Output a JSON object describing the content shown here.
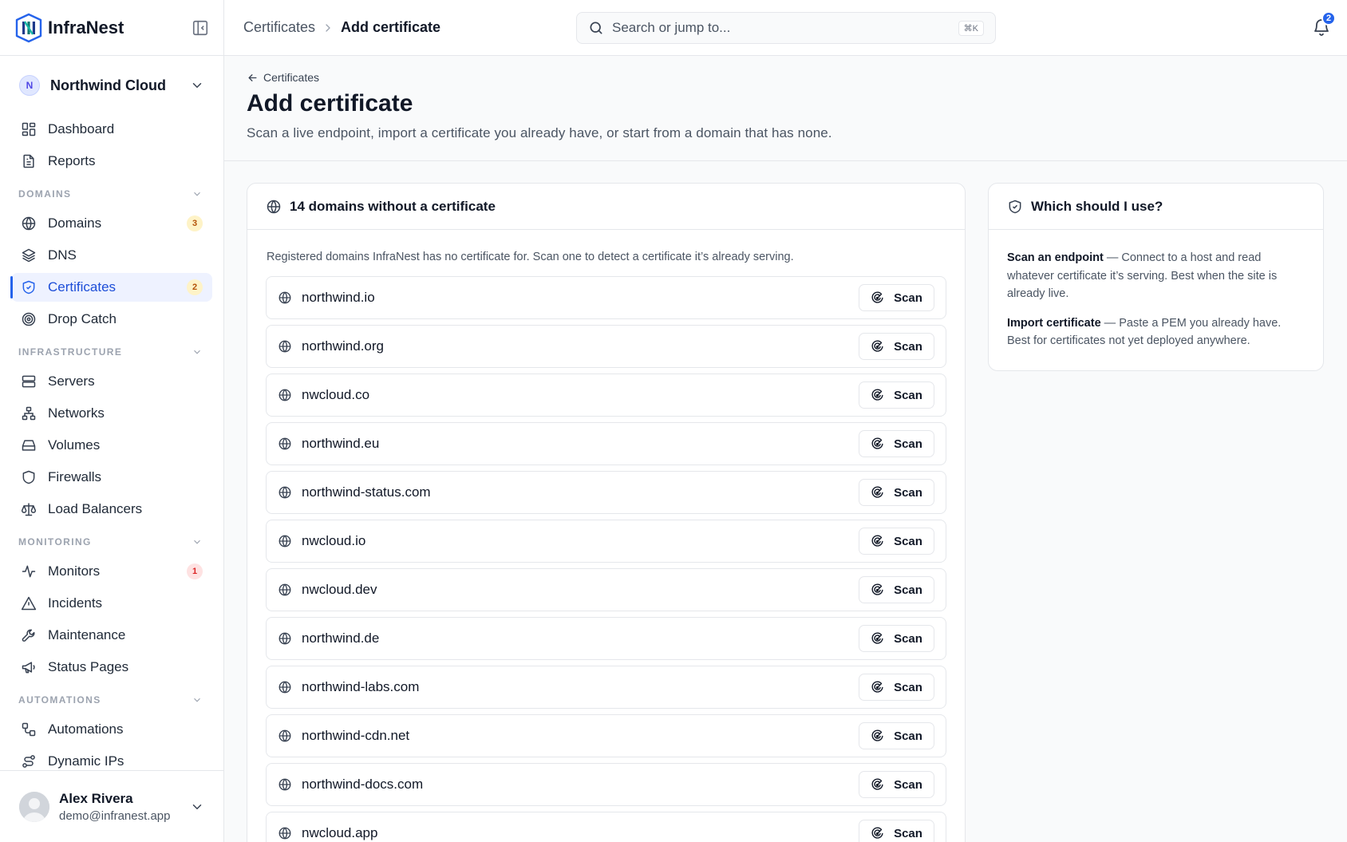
{
  "app": {
    "name": "InfraNest",
    "brand_color": "#2563eb",
    "accent_colors": {
      "amber_badge": "#b45309",
      "red_badge": "#dc2626"
    }
  },
  "workspace": {
    "initial": "N",
    "name": "Northwind Cloud"
  },
  "sidebar": {
    "top_items": [
      {
        "label": "Dashboard",
        "icon": "dashboard-icon"
      },
      {
        "label": "Reports",
        "icon": "document-icon"
      }
    ],
    "sections": [
      {
        "title": "DOMAINS",
        "items": [
          {
            "label": "Domains",
            "icon": "globe-icon",
            "badge": "3"
          },
          {
            "label": "DNS",
            "icon": "layers-icon"
          },
          {
            "label": "Certificates",
            "icon": "shield-check-icon",
            "badge": "2",
            "active": true
          },
          {
            "label": "Drop Catch",
            "icon": "target-icon"
          }
        ]
      },
      {
        "title": "INFRASTRUCTURE",
        "items": [
          {
            "label": "Servers",
            "icon": "server-icon"
          },
          {
            "label": "Networks",
            "icon": "network-icon"
          },
          {
            "label": "Volumes",
            "icon": "hard-drive-icon"
          },
          {
            "label": "Firewalls",
            "icon": "shield-icon"
          },
          {
            "label": "Load Balancers",
            "icon": "scale-icon"
          }
        ]
      },
      {
        "title": "MONITORING",
        "items": [
          {
            "label": "Monitors",
            "icon": "activity-icon",
            "badge": "1"
          },
          {
            "label": "Incidents",
            "icon": "alert-triangle-icon"
          },
          {
            "label": "Maintenance",
            "icon": "wrench-icon"
          },
          {
            "label": "Status Pages",
            "icon": "megaphone-icon"
          }
        ]
      },
      {
        "title": "AUTOMATIONS",
        "items": [
          {
            "label": "Automations",
            "icon": "workflow-icon"
          },
          {
            "label": "Dynamic IPs",
            "icon": "route-icon"
          }
        ]
      }
    ]
  },
  "user": {
    "name": "Alex Rivera",
    "email": "demo@infranest.app"
  },
  "header": {
    "breadcrumb_parent": "Certificates",
    "breadcrumb_current": "Add certificate",
    "search_placeholder": "Search or jump to...",
    "search_shortcut": "⌘K",
    "notifications_count": "2"
  },
  "page": {
    "back_label": "Certificates",
    "title": "Add certificate",
    "subtitle": "Scan a live endpoint, import a certificate you already have, or start from a domain that has none."
  },
  "domains_card": {
    "title": "14 domains without a certificate",
    "description": "Registered domains InfraNest has no certificate for. Scan one to detect a certificate it’s already serving.",
    "scan_label": "Scan",
    "domains": [
      "northwind.io",
      "northwind.org",
      "nwcloud.co",
      "northwind.eu",
      "northwind-status.com",
      "nwcloud.io",
      "nwcloud.dev",
      "northwind.de",
      "northwind-labs.com",
      "northwind-cdn.net",
      "northwind-docs.com",
      "nwcloud.app"
    ]
  },
  "help_card": {
    "title": "Which should I use?",
    "option1_title": "Scan an endpoint",
    "option1_text": " — Connect to a host and read whatever certificate it’s serving. Best when the site is already live.",
    "option2_title": "Import certificate",
    "option2_text": " — Paste a PEM you already have. Best for certificates not yet deployed anywhere."
  }
}
